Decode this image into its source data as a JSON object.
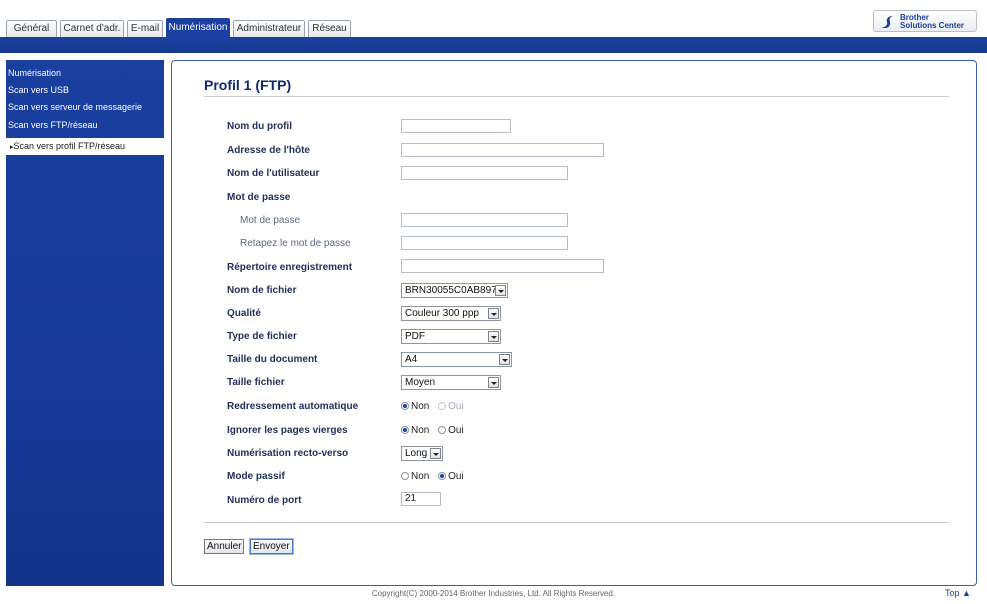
{
  "tabs": [
    {
      "label": "Général",
      "active": false
    },
    {
      "label": "Carnet d'adr.",
      "active": false
    },
    {
      "label": "E-mail",
      "active": false
    },
    {
      "label": "Numérisation",
      "active": true
    },
    {
      "label": "Administrateur",
      "active": false
    },
    {
      "label": "Réseau",
      "active": false
    }
  ],
  "logo": {
    "line1": "Brother",
    "line2": "Solutions Center"
  },
  "sidebar": {
    "items": [
      {
        "label": "Numérisation"
      },
      {
        "label": "Scan vers USB"
      },
      {
        "label": "Scan vers serveur de messagerie"
      },
      {
        "label": "Scan vers FTP/réseau"
      },
      {
        "label": "Scan vers profil FTP/réseau",
        "active": true
      }
    ]
  },
  "page": {
    "title": "Profil 1 (FTP)"
  },
  "form": {
    "profile_name": {
      "label": "Nom du profil",
      "value": ""
    },
    "host_address": {
      "label": "Adresse de l'hôte",
      "value": ""
    },
    "username": {
      "label": "Nom de l'utilisateur",
      "value": ""
    },
    "password_section": {
      "label": "Mot de passe"
    },
    "password": {
      "label": "Mot de passe",
      "value": ""
    },
    "password_confirm": {
      "label": "Retapez le mot de passe",
      "value": ""
    },
    "store_directory": {
      "label": "Répertoire enregistrement",
      "value": ""
    },
    "file_name": {
      "label": "Nom de fichier",
      "value": "BRN30055C0AB897"
    },
    "quality": {
      "label": "Qualité",
      "value": "Couleur 300 ppp"
    },
    "file_type": {
      "label": "Type de fichier",
      "value": "PDF"
    },
    "document_size": {
      "label": "Taille du document",
      "value": "A4"
    },
    "file_size": {
      "label": "Taille fichier",
      "value": "Moyen"
    },
    "auto_deskew": {
      "label": "Redressement automatique",
      "options": [
        "Non",
        "Oui"
      ],
      "selected": "Non"
    },
    "skip_blank": {
      "label": "Ignorer les pages vierges",
      "options": [
        "Non",
        "Oui"
      ],
      "selected": "Non"
    },
    "duplex": {
      "label": "Numérisation recto-verso",
      "value": "Long"
    },
    "passive_mode": {
      "label": "Mode passif",
      "options": [
        "Non",
        "Oui"
      ],
      "selected": "Oui"
    },
    "port_number": {
      "label": "Numéro de port",
      "value": "21"
    }
  },
  "buttons": {
    "cancel": "Annuler",
    "submit": "Envoyer"
  },
  "footer": {
    "copyright": "Copyright(C) 2000-2014 Brother Industries, Ltd. All Rights Reserved.",
    "top_link": "Top ▲"
  },
  "colors": {
    "accent": "#1a3f9e",
    "title": "#0f2a6e"
  }
}
